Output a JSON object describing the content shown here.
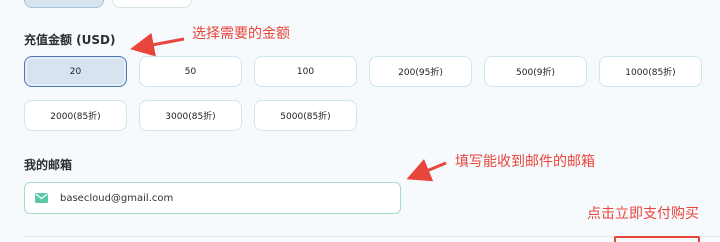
{
  "amount_section": {
    "label": "充值金额 (USD)",
    "options": [
      {
        "label": "20",
        "selected": true
      },
      {
        "label": "50",
        "selected": false
      },
      {
        "label": "100",
        "selected": false
      },
      {
        "label": "200(95折)",
        "selected": false
      },
      {
        "label": "500(9折)",
        "selected": false
      },
      {
        "label": "1000(85折)",
        "selected": false
      },
      {
        "label": "2000(85折)",
        "selected": false
      },
      {
        "label": "3000(85折)",
        "selected": false
      },
      {
        "label": "5000(85折)",
        "selected": false
      }
    ]
  },
  "email_section": {
    "label": "我的邮箱",
    "value": "basecloud@gmail.com",
    "icon": "mail-icon"
  },
  "annotations": {
    "select_amount": "选择需要的金额",
    "fill_email": "填写能收到邮件的邮箱",
    "click_buy": "点击立即支付购买"
  },
  "colors": {
    "annotation": "#e8453c",
    "selected_border": "#4a76ab",
    "email_border": "#a7dccc",
    "mail_icon": "#5cc6a7"
  }
}
